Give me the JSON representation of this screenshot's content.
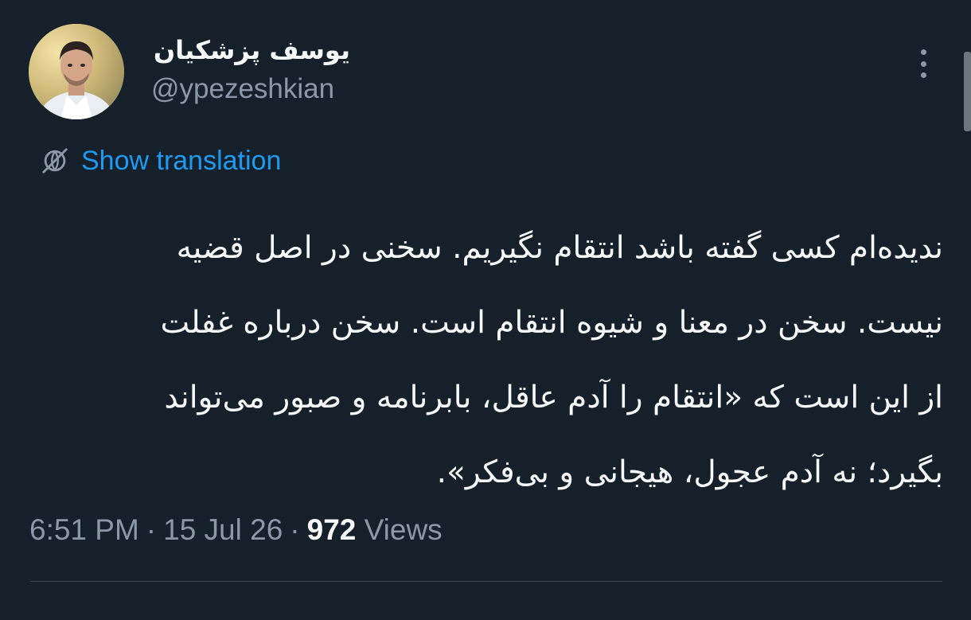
{
  "author": {
    "display_name": "یوسف پزشکیان",
    "handle": "@ypezeshkian",
    "avatar_icon": "profile-photo"
  },
  "translation": {
    "label": "Show translation",
    "icon": "globe-icon",
    "color": "#1d9bf0"
  },
  "tweet": {
    "lines": [
      "ندیده‌ام کسی گفته باشد انتقام نگیریم. سخنی در اصل قضیه",
      "نیست. سخن در معنا و شیوه انتقام است. سخن درباره غفلت",
      "از این است که «انتقام را آدم عاقل، بابرنامه و صبور می‌تواند",
      "بگیرد؛ نه آدم عجول، هیجانی و بی‌فکر»."
    ]
  },
  "meta": {
    "time": "6:51 PM",
    "separator": "·",
    "date": "15 Jul 26",
    "views_count": "972",
    "views_label": "Views"
  },
  "colors": {
    "background": "#15202b",
    "primary_text": "#f7f9f9",
    "secondary_text": "#8b98a5",
    "accent": "#1d9bf0",
    "divider": "#38444d"
  }
}
